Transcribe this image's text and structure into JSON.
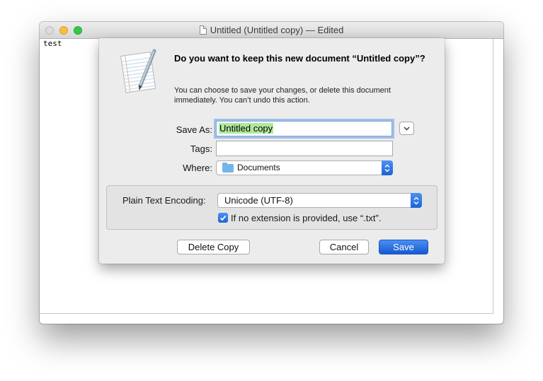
{
  "window": {
    "title": "Untitled (Untitled copy)",
    "title_separator": "—",
    "title_status": "Edited",
    "document_text": "test"
  },
  "sheet": {
    "heading": "Do you want to keep this new document “Untitled copy”?",
    "message": "You can choose to save your changes, or delete this document immediately. You can’t undo this action.",
    "save_as": {
      "label": "Save As:",
      "value": "Untitled copy"
    },
    "tags": {
      "label": "Tags:",
      "value": ""
    },
    "where": {
      "label": "Where:",
      "value": "Documents",
      "icon": "folder-icon"
    },
    "encoding": {
      "label": "Plain Text Encoding:",
      "value": "Unicode (UTF-8)"
    },
    "extension_checkbox": {
      "label": "If no extension is provided, use “.txt”.",
      "checked": true
    },
    "buttons": {
      "delete": "Delete Copy",
      "cancel": "Cancel",
      "save": "Save"
    }
  },
  "colors": {
    "accent": "#1a63d8",
    "selection": "#b0e89b",
    "traffic_close": "#dcdcdc",
    "traffic_minimize": "#fdbc40",
    "traffic_zoom": "#34c84a"
  }
}
